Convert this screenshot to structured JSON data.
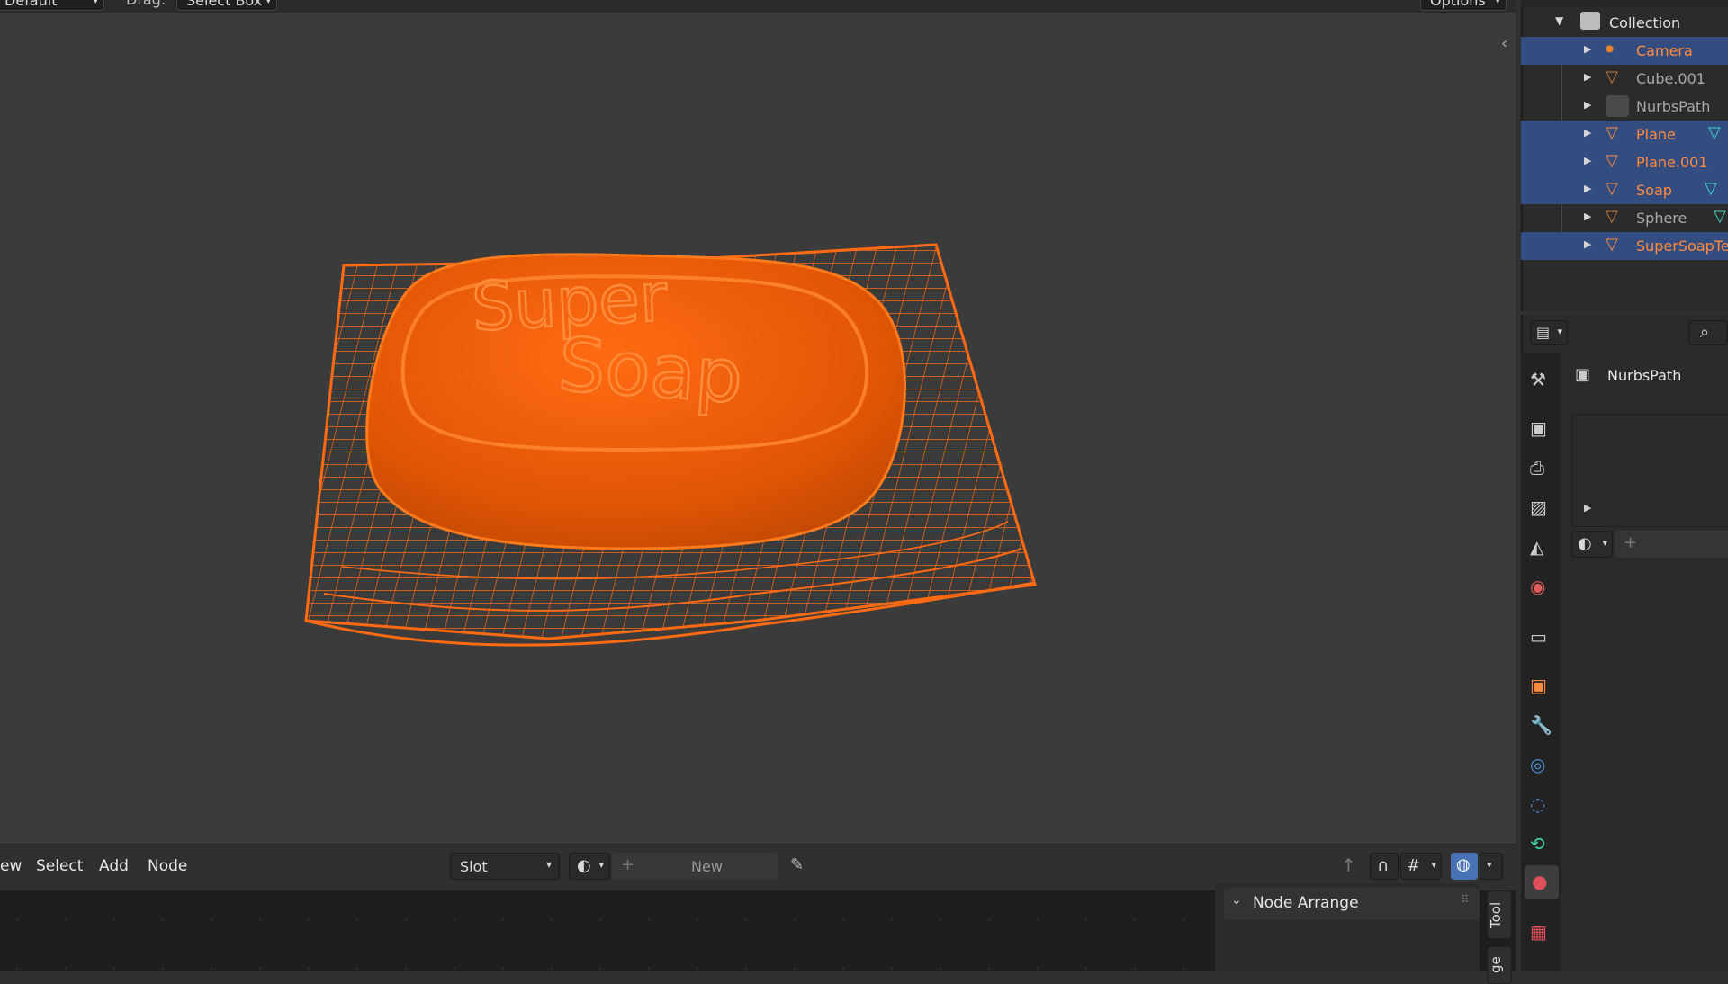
{
  "viewport": {
    "header": {
      "mode_value": "Default",
      "drag_label": "Drag:",
      "drag_value": "Select Box",
      "options_label": "Options"
    },
    "object_text": [
      "Super",
      "Soap"
    ]
  },
  "node_editor": {
    "menu": [
      "ew",
      "Select",
      "Add",
      "Node"
    ],
    "slot_label": "Slot",
    "new_label": "New",
    "side_tabs": [
      "Tool",
      "ge"
    ],
    "panel_title": "Node Arrange"
  },
  "outliner": {
    "collection_label": "Collection",
    "items": [
      {
        "name": "Camera",
        "icon": "camera-icon",
        "selected": true
      },
      {
        "name": "Cube.001",
        "icon": "mesh-icon",
        "selected": false
      },
      {
        "name": "NurbsPath",
        "icon": "curve-icon",
        "selected": false
      },
      {
        "name": "Plane",
        "icon": "mesh-icon",
        "selected": true
      },
      {
        "name": "Plane.001",
        "icon": "mesh-icon",
        "selected": true
      },
      {
        "name": "Soap",
        "icon": "mesh-icon",
        "selected": true
      },
      {
        "name": "Sphere",
        "icon": "mesh-icon",
        "selected": false
      },
      {
        "name": "SuperSoapTex",
        "icon": "mesh-icon",
        "selected": true
      }
    ]
  },
  "properties": {
    "object_name": "NurbsPath"
  },
  "colors": {
    "accent_orange": "#ff7a1a",
    "selection_blue": "#334d80",
    "object_orange": "#e85c0c"
  }
}
